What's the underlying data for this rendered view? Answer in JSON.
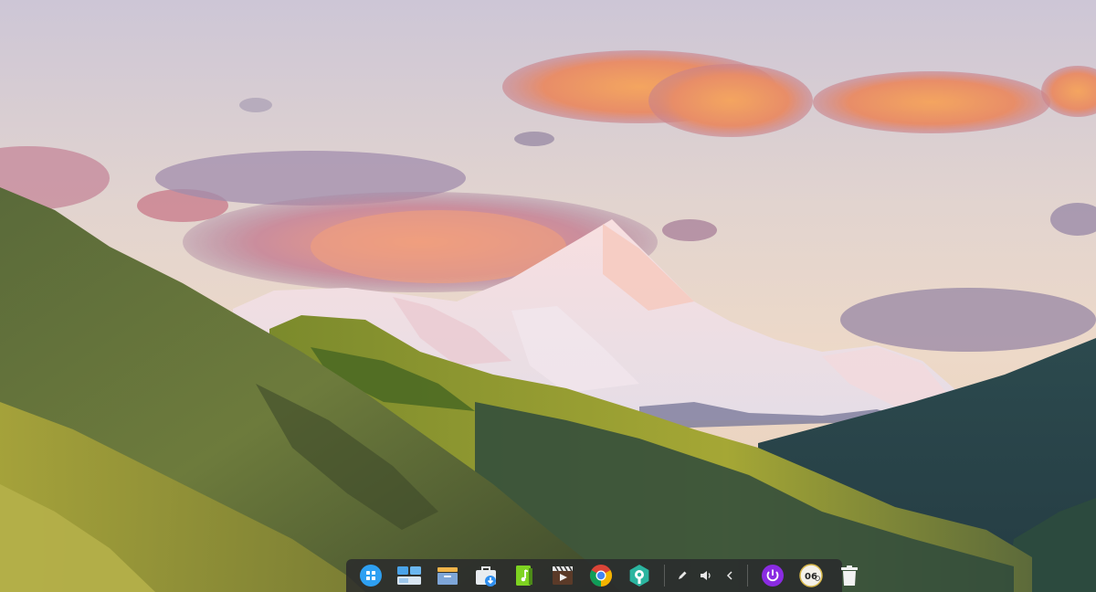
{
  "dock": {
    "items": [
      {
        "name": "launcher",
        "icon": "launcher-icon"
      },
      {
        "name": "multitasking-view",
        "icon": "multitasking-icon"
      },
      {
        "name": "file-manager",
        "icon": "file-manager-icon"
      },
      {
        "name": "app-store",
        "icon": "app-store-icon"
      },
      {
        "name": "music-player",
        "icon": "music-player-icon"
      },
      {
        "name": "movie-player",
        "icon": "movie-player-icon"
      },
      {
        "name": "chrome-browser",
        "icon": "chrome-icon"
      },
      {
        "name": "control-center",
        "icon": "control-center-icon"
      }
    ],
    "tray": [
      {
        "name": "pen-tray",
        "icon": "pen-icon"
      },
      {
        "name": "volume-tray",
        "icon": "volume-icon"
      },
      {
        "name": "expand-tray",
        "icon": "chevron-left-icon"
      }
    ],
    "power": {
      "icon": "power-icon"
    },
    "clock": {
      "text": "06",
      "icon": "clock-icon"
    },
    "trash": {
      "icon": "trash-icon"
    }
  },
  "colors": {
    "dock_bg": "#28282c",
    "launcher": "#2ea0f2",
    "power": "#8a2be2",
    "music": "#7ed321"
  }
}
